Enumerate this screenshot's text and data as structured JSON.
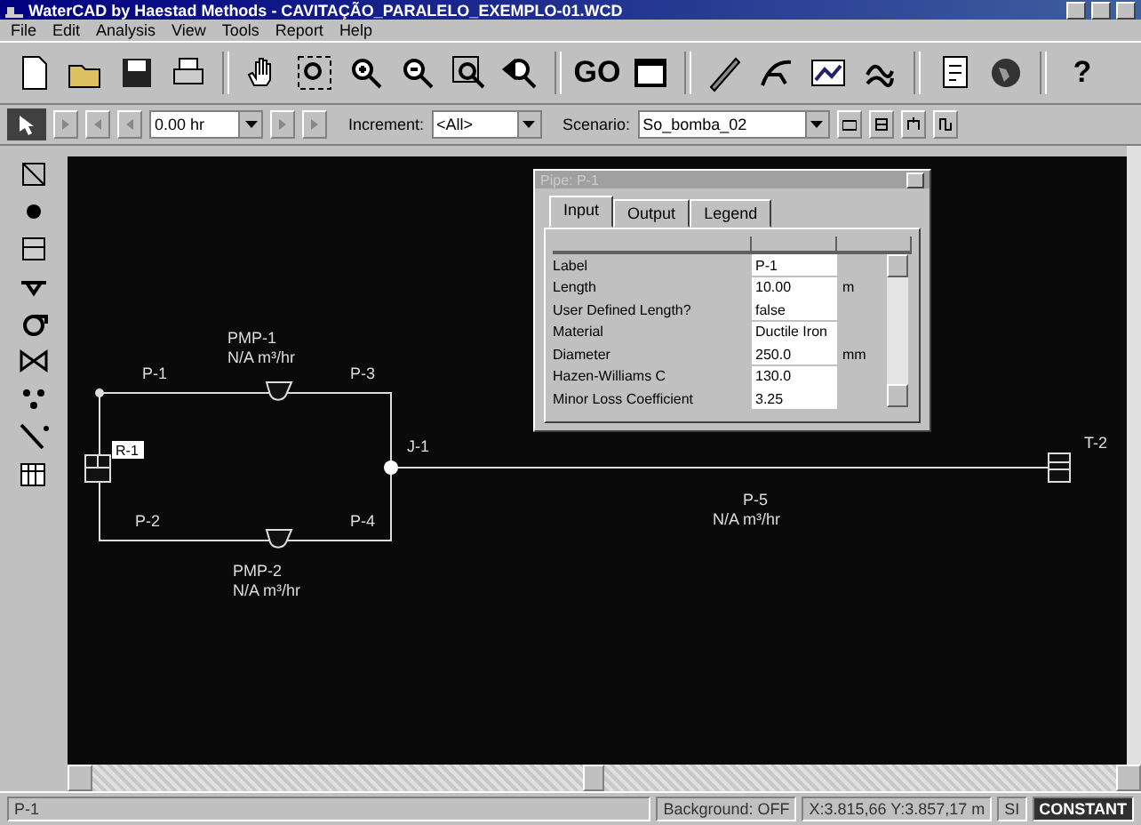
{
  "window": {
    "title": "WaterCAD by Haestad Methods - CAVITAÇÃO_PARALELO_EXEMPLO-01.WCD"
  },
  "menu": [
    "File",
    "Edit",
    "Analysis",
    "View",
    "Tools",
    "Report",
    "Help"
  ],
  "toolbar": {
    "text_buttons": [
      "GO",
      "?"
    ]
  },
  "time_bar": {
    "time": "0.00 hr",
    "increment_label": "Increment:",
    "increment": "<All>",
    "scenario_label": "Scenario:",
    "scenario": "So_bomba_02"
  },
  "canvas": {
    "pipes": [
      {
        "label": "P-1"
      },
      {
        "label": "P-3"
      },
      {
        "label": "P-2"
      },
      {
        "label": "P-4"
      },
      {
        "label": "P-5",
        "flow": "N/A m³/hr"
      }
    ],
    "pumps": [
      {
        "label": "PMP-1",
        "flow": "N/A m³/hr"
      },
      {
        "label": "PMP-2",
        "flow": "N/A m³/hr"
      }
    ],
    "junction": {
      "label": "J-1"
    },
    "reservoir": {
      "label": "R-1",
      "selected": true
    },
    "tank": {
      "label": "T-2"
    }
  },
  "dialog": {
    "title": "Pipe: P-1",
    "tabs": [
      {
        "label": "Input",
        "selected": true
      },
      {
        "label": "Output",
        "selected": false
      },
      {
        "label": "Legend",
        "selected": false
      }
    ],
    "rows": [
      {
        "name": "Label",
        "value": "P-1"
      },
      {
        "name": "Length",
        "value": "10.00",
        "unit": "m"
      },
      {
        "name": "User Defined Length?",
        "value": "false"
      },
      {
        "name": "Material",
        "value": "Ductile Iron"
      },
      {
        "name": "Diameter",
        "value": "250.0",
        "unit": "mm"
      },
      {
        "name": "Hazen-Williams C",
        "value": "130.0"
      },
      {
        "name": "Minor Loss Coefficient",
        "value": "3.25"
      }
    ]
  },
  "status_bar": [
    {
      "text": "P-1",
      "kind": "plain"
    },
    {
      "text": "Background: OFF",
      "kind": "plain"
    },
    {
      "text": "X:3.815,66 Y:3.857,17 m",
      "kind": "plain"
    },
    {
      "text": "SI",
      "kind": "plain"
    },
    {
      "text": "CONSTANT",
      "kind": "dark"
    }
  ]
}
